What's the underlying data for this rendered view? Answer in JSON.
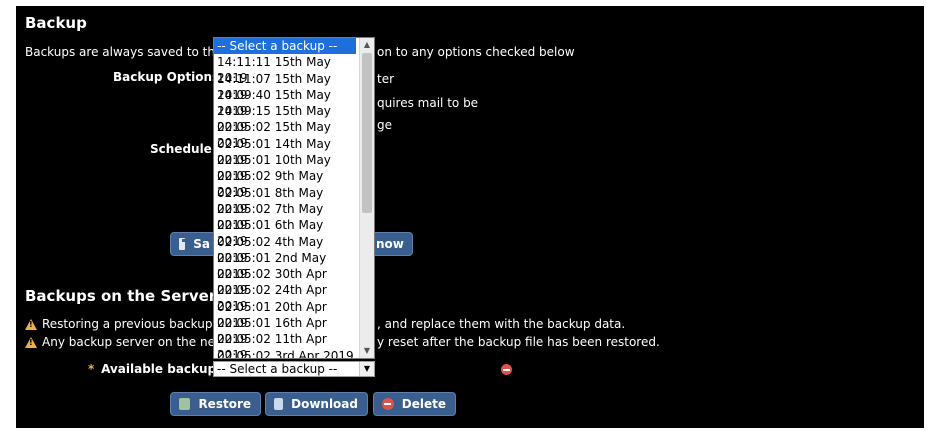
{
  "backup": {
    "title": "Backup",
    "desc_left": "Backups are always saved to the",
    "desc_right": "on to any options checked below",
    "options_label": "Backup Options",
    "option_frag1": "ter",
    "option_frag2": "quires mail to be",
    "option_frag3": "ge",
    "schedule_label": "Schedule",
    "save_frag": "Sa",
    "now_frag": "now"
  },
  "server": {
    "title": "Backups on the Server",
    "warn1_left": "Restoring a previous backup",
    "warn1_right": ", and replace them with the backup data.",
    "warn2_left": "Any backup server on the net",
    "warn2_right": "y reset after the backup file has been restored.",
    "available_label": "Available backups",
    "required_marker": "*",
    "select_value": "-- Select a backup --",
    "restore_label": "Restore",
    "download_label": "Download",
    "delete_label": "Delete"
  },
  "dropdown": {
    "options": [
      "-- Select a backup --",
      "14:11:11 15th May 2019",
      "14:11:07 15th May 2019",
      "14:09:40 15th May 2019",
      "14:09:15 15th May 2019",
      "02:05:02 15th May 2019",
      "02:05:01 14th May 2019",
      "02:05:01 10th May 2019",
      "02:05:02 9th May 2019",
      "02:05:01 8th May 2019",
      "02:05:02 7th May 2019",
      "02:05:01 6th May 2019",
      "02:05:02 4th May 2019",
      "02:05:01 2nd May 2019",
      "02:05:02 30th Apr 2019",
      "02:05:02 24th Apr 2019",
      "02:05:01 20th Apr 2019",
      "02:05:01 16th Apr 2019",
      "02:05:02 11th Apr 2019",
      "02:05:02 3rd Apr 2019"
    ],
    "selected_index": 0
  },
  "colors": {
    "panel_bg": "#000000",
    "button_bg": "#3a5f8e",
    "warning": "#f0ad4e",
    "error": "#d9534f",
    "option_highlight": "#1e6fdc"
  }
}
